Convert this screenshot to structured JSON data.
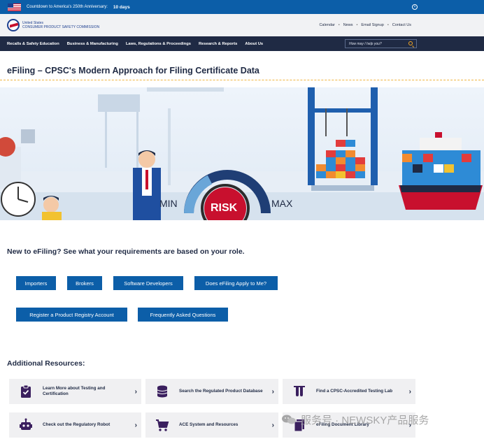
{
  "topbar": {
    "countdown_label": "Countdown to America's 250th Anniversary:",
    "days": "10 days"
  },
  "header": {
    "agency_line1": "United States",
    "agency_line2": "CONSUMER PRODUCT SAFETY COMMISSION",
    "utility_links": [
      "Calendar",
      "News",
      "Email Signup",
      "Contact Us"
    ]
  },
  "nav": {
    "items": [
      "Recalls & Safety Education",
      "Business & Manufacturing",
      "Laws, Regulations & Proceedings",
      "Research & Reports",
      "About Us"
    ],
    "search_placeholder": "How may I help you?"
  },
  "page": {
    "title": "eFiling – CPSC's Modern Approach for Filing Certificate Data"
  },
  "hero": {
    "gauge_min": "MIN",
    "gauge_center": "RISK",
    "gauge_max": "MAX"
  },
  "roles": {
    "heading": "New to eFiling? See what your requirements are based on your role.",
    "buttons": [
      "Importers",
      "Brokers",
      "Software Developers",
      "Does eFiling Apply to Me?",
      "Register a Product Registry Account",
      "Frequently Asked Questions"
    ]
  },
  "resources": {
    "heading": "Additional Resources:",
    "cards": [
      {
        "label": "Learn More about Testing and Certification",
        "icon": "clipboard-check-icon"
      },
      {
        "label": "Search the Regulated Product Database",
        "icon": "database-icon"
      },
      {
        "label": "Find a CPSC-Accredited Testing Lab",
        "icon": "test-tubes-icon"
      },
      {
        "label": "Check out the Regulatory Robot",
        "icon": "robot-icon"
      },
      {
        "label": "ACE System and Resources",
        "icon": "shopping-cart-icon"
      },
      {
        "label": "eFiling Document Library",
        "icon": "documents-icon"
      }
    ]
  },
  "watermark": {
    "text": "服务号 · NEWSKY产品服务"
  },
  "colors": {
    "primary_blue": "#0c5ea8",
    "navy": "#1f2a44",
    "accent_gold": "#f5a623",
    "risk_red": "#c8102e"
  }
}
